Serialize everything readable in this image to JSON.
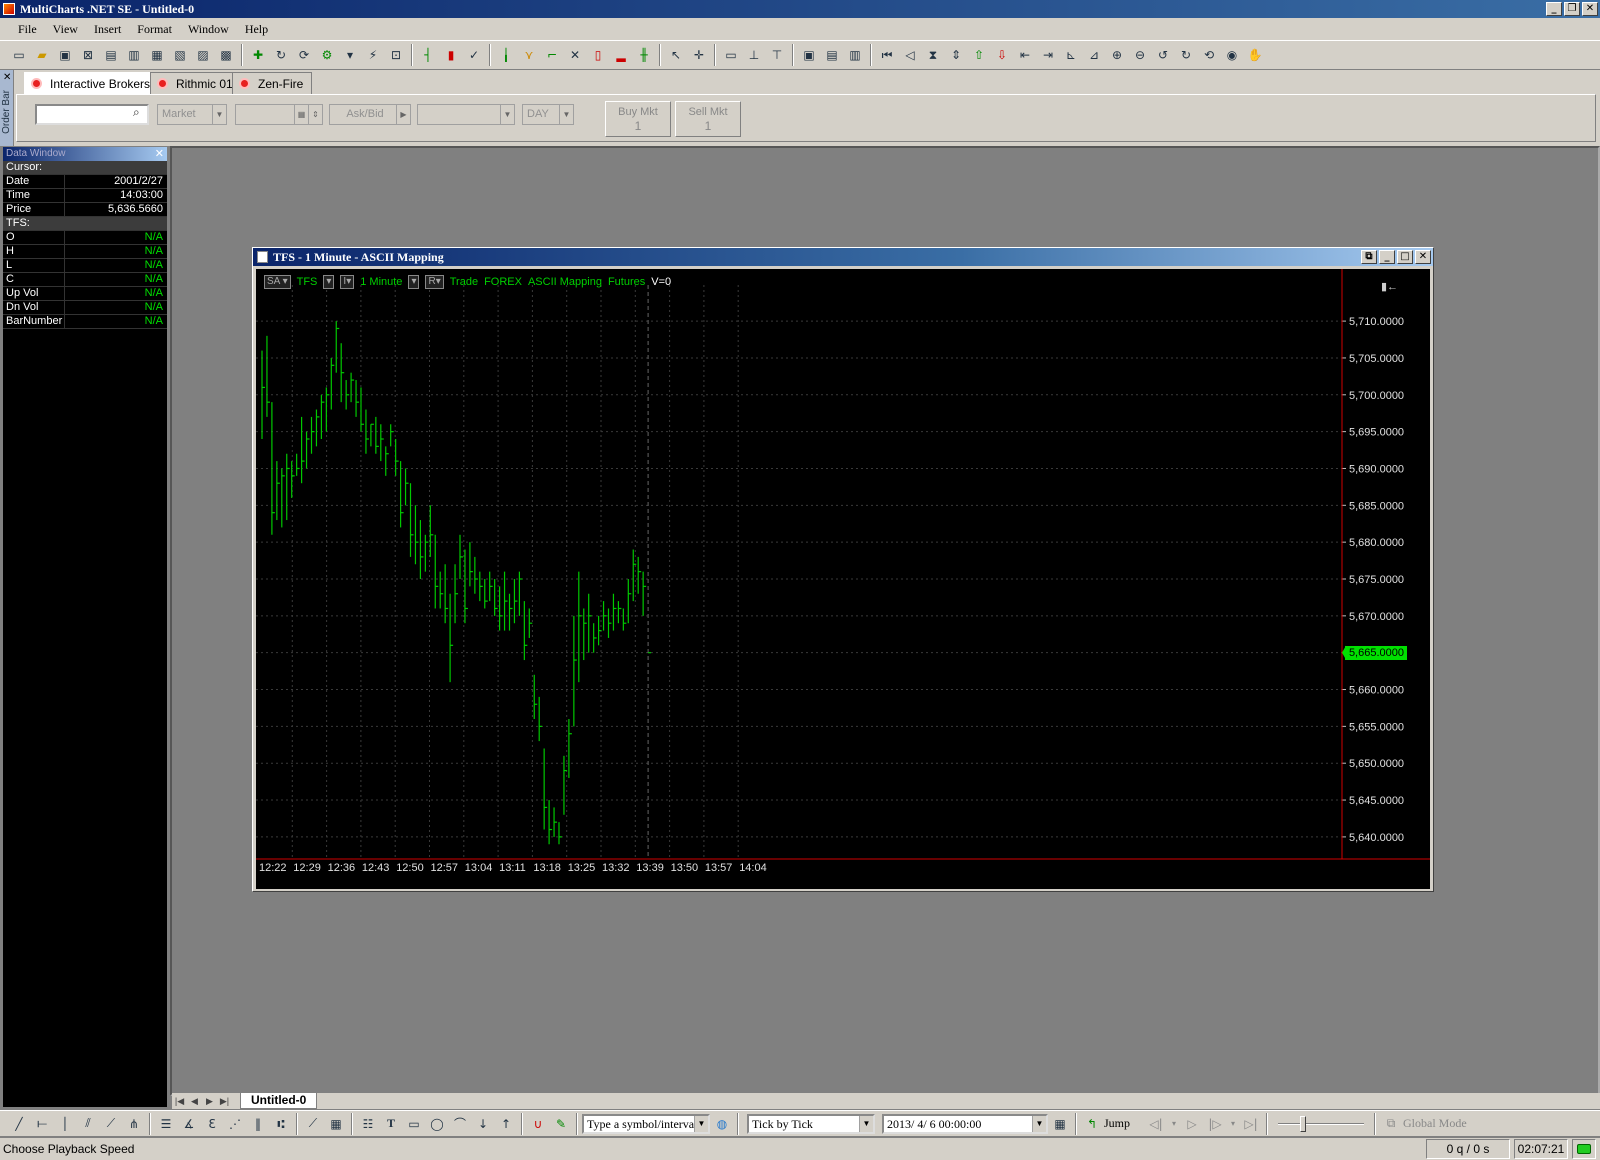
{
  "window": {
    "title": "MultiCharts .NET SE - Untitled-0"
  },
  "menu": [
    "File",
    "View",
    "Insert",
    "Format",
    "Window",
    "Help"
  ],
  "toolbar_icons": [
    "new-workspace-icon",
    "open-icon",
    "save-icon",
    "close-icon",
    "new-chart-icon",
    "new-scanner-icon",
    "new-dom-icon",
    "new-order-icon",
    "new-portfolio-icon",
    "new-report-icon",
    "insert-study-icon",
    "format-study-icon",
    "refresh-icon",
    "strategy-icon",
    "bar-style-icon",
    "candle-icon",
    "line-icon",
    "ohlc-icon",
    "point-figure-icon",
    "chart-type-icon",
    "cursor-icon",
    "crosshair-icon",
    "comment-icon",
    "order-buy-icon",
    "order-sell-icon",
    "layout-icon",
    "zoom-in-icon",
    "zoom-out-icon",
    "hand-icon"
  ],
  "tradebar": {
    "side_label": "Order Bar",
    "brokers": [
      {
        "name": "Interactive Brokers",
        "active": true
      },
      {
        "name": "Rithmic 01",
        "active": false
      },
      {
        "name": "Zen-Fire",
        "active": false
      }
    ],
    "symbol_value": "",
    "order_type": "Market",
    "price_value": "",
    "quote": "Ask/Bid",
    "account": "",
    "tif": "DAY",
    "buy_label": "Buy Mkt",
    "buy_qty": "1",
    "sell_label": "Sell Mkt",
    "sell_qty": "1"
  },
  "data_window": {
    "title": "Data Window",
    "cursor_label": "Cursor:",
    "cursor_rows": [
      {
        "k": "Date",
        "v": "2001/2/27"
      },
      {
        "k": "Time",
        "v": "14:03:00"
      },
      {
        "k": "Price",
        "v": "5,636.5660"
      }
    ],
    "series_label": "TFS:",
    "series_rows": [
      {
        "k": "O",
        "v": "N/A"
      },
      {
        "k": "H",
        "v": "N/A"
      },
      {
        "k": "L",
        "v": "N/A"
      },
      {
        "k": "C",
        "v": "N/A"
      },
      {
        "k": "Up Vol",
        "v": "N/A"
      },
      {
        "k": "Dn Vol",
        "v": "N/A"
      },
      {
        "k": "BarNumber",
        "v": "N/A"
      }
    ]
  },
  "chart_window": {
    "title": "TFS - 1 Minute - ASCII Mapping",
    "legend": {
      "sa": "SA",
      "symbol": "TFS",
      "interval": "1 Minute",
      "r": "R",
      "fields": [
        "Trade",
        "FOREX",
        "ASCII Mapping",
        "Futures"
      ],
      "vol": "V=0"
    },
    "last_price": "5,665.0000"
  },
  "chart_data": {
    "type": "bar",
    "ylim": [
      5637,
      5713
    ],
    "y_ticks": [
      5640,
      5645,
      5650,
      5655,
      5660,
      5665,
      5670,
      5675,
      5680,
      5685,
      5690,
      5695,
      5700,
      5705,
      5710
    ],
    "y_tick_labels": [
      "5,640.0000",
      "5,645.0000",
      "5,650.0000",
      "5,655.0000",
      "5,660.0000",
      "5,665.0000",
      "5,670.0000",
      "5,675.0000",
      "5,680.0000",
      "5,685.0000",
      "5,690.0000",
      "5,695.0000",
      "5,700.0000",
      "5,705.0000",
      "5,710.0000"
    ],
    "x_tick_labels": [
      "12:22",
      "12:29",
      "12:36",
      "12:43",
      "12:50",
      "12:57",
      "13:04",
      "13:11",
      "13:18",
      "13:25",
      "13:32",
      "13:39",
      "13:50",
      "13:57",
      "14:04"
    ],
    "bar_count": 79,
    "cursor_bar": 78,
    "bars": [
      [
        5706,
        5694,
        5701
      ],
      [
        5708,
        5697,
        5699
      ],
      [
        5699,
        5681,
        5684
      ],
      [
        5691,
        5683,
        5688
      ],
      [
        5690,
        5682,
        5689
      ],
      [
        5692,
        5683,
        5690
      ],
      [
        5691,
        5686,
        5689
      ],
      [
        5692,
        5689,
        5690
      ],
      [
        5697,
        5688,
        5691
      ],
      [
        5695,
        5690,
        5694
      ],
      [
        5697,
        5692,
        5695
      ],
      [
        5698,
        5693,
        5697
      ],
      [
        5700,
        5694,
        5699
      ],
      [
        5701,
        5695,
        5700
      ],
      [
        5705,
        5698,
        5704
      ],
      [
        5710,
        5703,
        5709
      ],
      [
        5707,
        5699,
        5703
      ],
      [
        5702,
        5698,
        5700
      ],
      [
        5703,
        5699,
        5702
      ],
      [
        5702,
        5697,
        5699
      ],
      [
        5701,
        5695,
        5696
      ],
      [
        5698,
        5692,
        5694
      ],
      [
        5696,
        5693,
        5696
      ],
      [
        5697,
        5692,
        5693
      ],
      [
        5696,
        5691,
        5694
      ],
      [
        5693,
        5689,
        5692
      ],
      [
        5696,
        5693,
        5695
      ],
      [
        5694,
        5689,
        5691
      ],
      [
        5691,
        5682,
        5684
      ],
      [
        5690,
        5685,
        5688
      ],
      [
        5688,
        5678,
        5681
      ],
      [
        5685,
        5677,
        5680
      ],
      [
        5683,
        5675,
        5678
      ],
      [
        5681,
        5676,
        5680
      ],
      [
        5685,
        5678,
        5681
      ],
      [
        5681,
        5671,
        5674
      ],
      [
        5676,
        5671,
        5673
      ],
      [
        5677,
        5669,
        5671
      ],
      [
        5673,
        5661,
        5666
      ],
      [
        5677,
        5669,
        5673
      ],
      [
        5681,
        5675,
        5678
      ],
      [
        5679,
        5669,
        5671
      ],
      [
        5680,
        5674,
        5676
      ],
      [
        5678,
        5673,
        5675
      ],
      [
        5676,
        5672,
        5674
      ],
      [
        5675,
        5671,
        5672
      ],
      [
        5676,
        5672,
        5674
      ],
      [
        5675,
        5670,
        5671
      ],
      [
        5674,
        5668,
        5670
      ],
      [
        5676,
        5668,
        5672
      ],
      [
        5673,
        5668,
        5671
      ],
      [
        5675,
        5669,
        5672
      ],
      [
        5676,
        5670,
        5675
      ],
      [
        5672,
        5664,
        5666
      ],
      [
        5671,
        5667,
        5669
      ],
      [
        5662,
        5656,
        5658
      ],
      [
        5659,
        5653,
        5655
      ],
      [
        5652,
        5641,
        5644
      ],
      [
        5645,
        5639,
        5641
      ],
      [
        5644,
        5640,
        5642
      ],
      [
        5642,
        5639,
        5640
      ],
      [
        5651,
        5643,
        5649
      ],
      [
        5656,
        5648,
        5654
      ],
      [
        5670,
        5655,
        5664
      ],
      [
        5676,
        5661,
        5670
      ],
      [
        5671,
        5664,
        5669
      ],
      [
        5673,
        5665,
        5670
      ],
      [
        5669,
        5665,
        5667
      ],
      [
        5670,
        5666,
        5668
      ],
      [
        5672,
        5668,
        5670
      ],
      [
        5671,
        5667,
        5669
      ],
      [
        5673,
        5668,
        5671
      ],
      [
        5672,
        5669,
        5671
      ],
      [
        5671,
        5668,
        5669
      ],
      [
        5675,
        5669,
        5673
      ],
      [
        5679,
        5672,
        5677
      ],
      [
        5678,
        5673,
        5676
      ],
      [
        5676,
        5670,
        5674
      ],
      [
        5665,
        5665,
        5665
      ]
    ]
  },
  "bottom": {
    "sheet_tab": "Untitled-0",
    "symbol_combo": "Type a symbol/interval",
    "playback_speed": "Tick by Tick",
    "playback_date": "2013/ 4/ 6 00:00:00",
    "jump_label": "Jump",
    "global_mode": "Global Mode"
  },
  "status": {
    "message": "Choose Playback Speed",
    "queue": "0 q / 0 s",
    "clock": "02:07:21"
  }
}
